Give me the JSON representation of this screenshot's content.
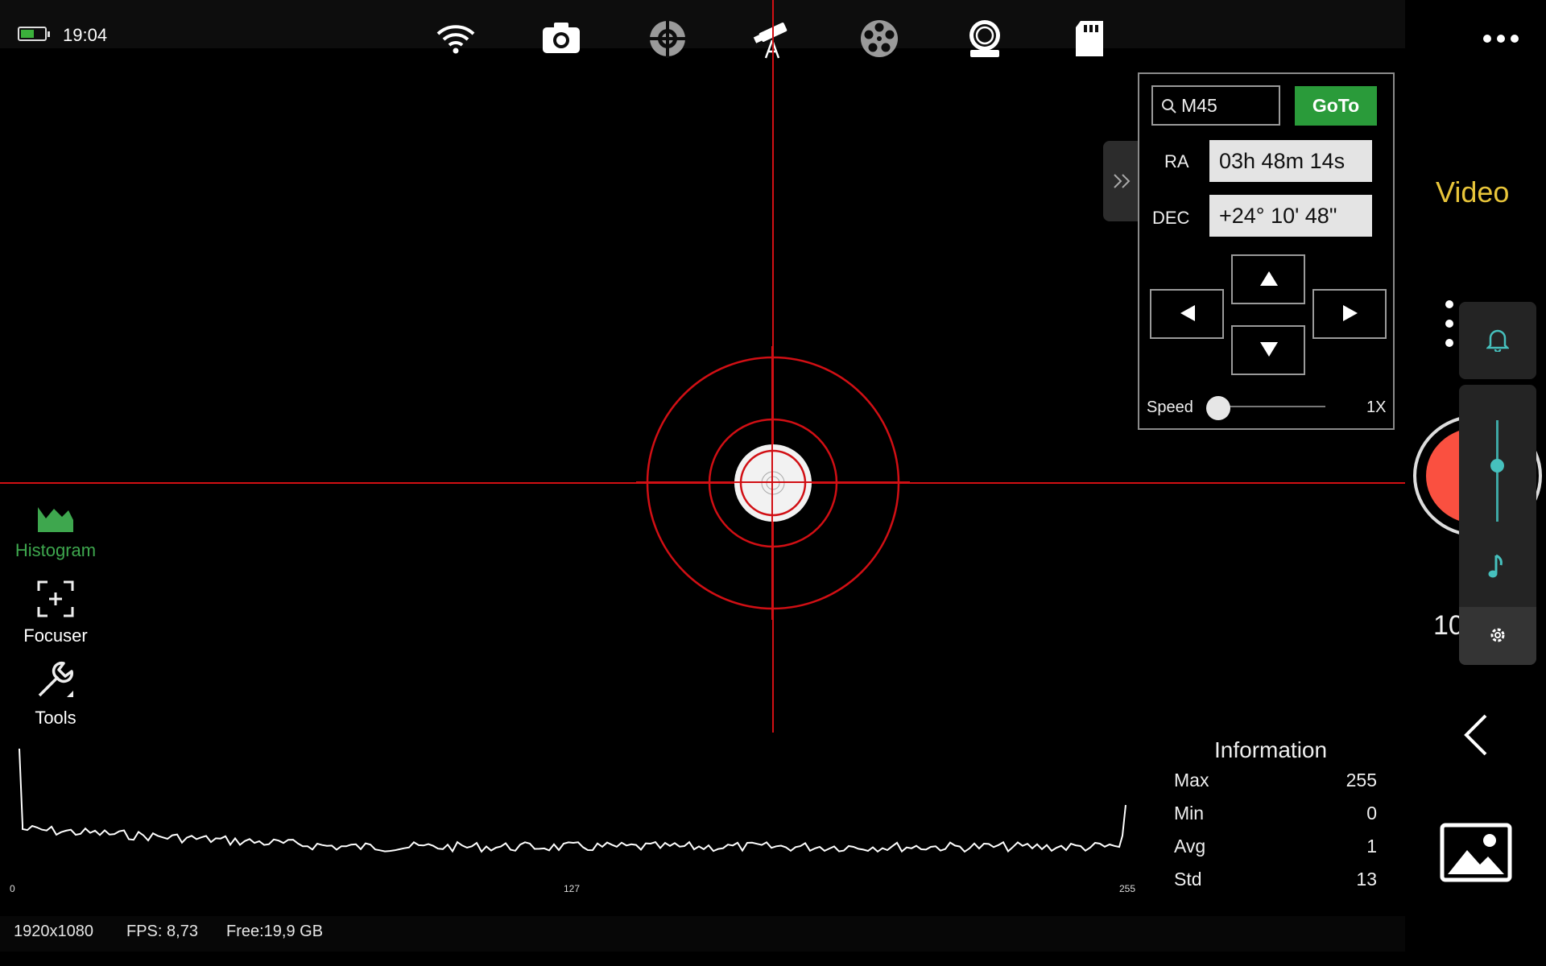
{
  "status_top": {
    "time": "19:04",
    "battery_color": "#3bb13b"
  },
  "top_icons": [
    "wifi-icon",
    "camera-icon",
    "crosshair-target-icon",
    "telescope-icon",
    "filter-wheel-icon",
    "focuser-ring-icon",
    "sd-card-icon"
  ],
  "left_tools": [
    {
      "label": "Histogram",
      "icon": "histogram-icon",
      "active": true
    },
    {
      "label": "Focuser",
      "icon": "focus-bracket-icon"
    },
    {
      "label": "Tools",
      "icon": "wrench-icon"
    }
  ],
  "goto_panel": {
    "search_value": "M45",
    "goto_label": "GoTo",
    "ra_label": "RA",
    "ra_value": "03h 48m 14s",
    "dec_label": "DEC",
    "dec_value": "+24° 10' 48\"",
    "speed_label": "Speed",
    "speed_value": "1X",
    "speed_level": 0
  },
  "mode": {
    "label": "Video",
    "counter": "10"
  },
  "histogram": {
    "tick_labels": [
      "0",
      "127",
      "255"
    ]
  },
  "information": {
    "title": "Information",
    "rows": [
      {
        "key": "Max",
        "value": "255"
      },
      {
        "key": "Min",
        "value": "0"
      },
      {
        "key": "Avg",
        "value": "1"
      },
      {
        "key": "Std",
        "value": "13"
      }
    ]
  },
  "status_bottom": {
    "resolution": "1920x1080",
    "fps": "FPS: 8,73",
    "free": "Free:19,9 GB"
  },
  "colors": {
    "accent_green": "#2a9b3a",
    "crosshair_red": "#d10f14",
    "video_yellow": "#e8c53a",
    "record_red": "#fa5040",
    "slider_teal": "#46c0bd"
  }
}
